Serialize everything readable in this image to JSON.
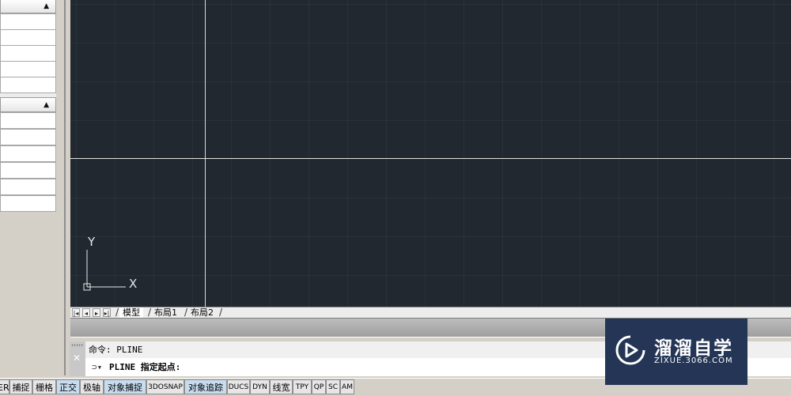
{
  "canvas": {
    "ucs_y_label": "Y",
    "ucs_x_label": "X"
  },
  "layout_tabs": {
    "nav_icons": [
      "first-tab-icon",
      "prev-tab-icon",
      "next-tab-icon",
      "last-tab-icon"
    ],
    "tabs": [
      {
        "label": "模型",
        "active": true
      },
      {
        "label": "布局1",
        "active": false
      },
      {
        "label": "布局2",
        "active": false
      }
    ]
  },
  "command": {
    "history_line": "命令:  PLINE",
    "current_prompt": "PLINE 指定起点:"
  },
  "status_bar": {
    "buttons": [
      {
        "label": "ER",
        "on": false
      },
      {
        "label": "捕捉",
        "on": false
      },
      {
        "label": "栅格",
        "on": false
      },
      {
        "label": "正交",
        "on": true
      },
      {
        "label": "极轴",
        "on": false
      },
      {
        "label": "对象捕捉",
        "on": true
      },
      {
        "label": "3DOSNAP",
        "on": false
      },
      {
        "label": "对象追踪",
        "on": true
      },
      {
        "label": "DUCS",
        "on": false
      },
      {
        "label": "DYN",
        "on": false
      },
      {
        "label": "线宽",
        "on": false
      },
      {
        "label": "TPY",
        "on": false
      },
      {
        "label": "QP",
        "on": false
      },
      {
        "label": "SC",
        "on": false
      },
      {
        "label": "AM",
        "on": false
      }
    ]
  },
  "watermark": {
    "brand": "溜溜自学",
    "url": "ZIXUE.3066.COM"
  },
  "colors": {
    "canvas_bg": "#212830",
    "crosshair": "#dcdcdc",
    "status_on": "#c7dcef",
    "watermark_bg": "#243556"
  }
}
